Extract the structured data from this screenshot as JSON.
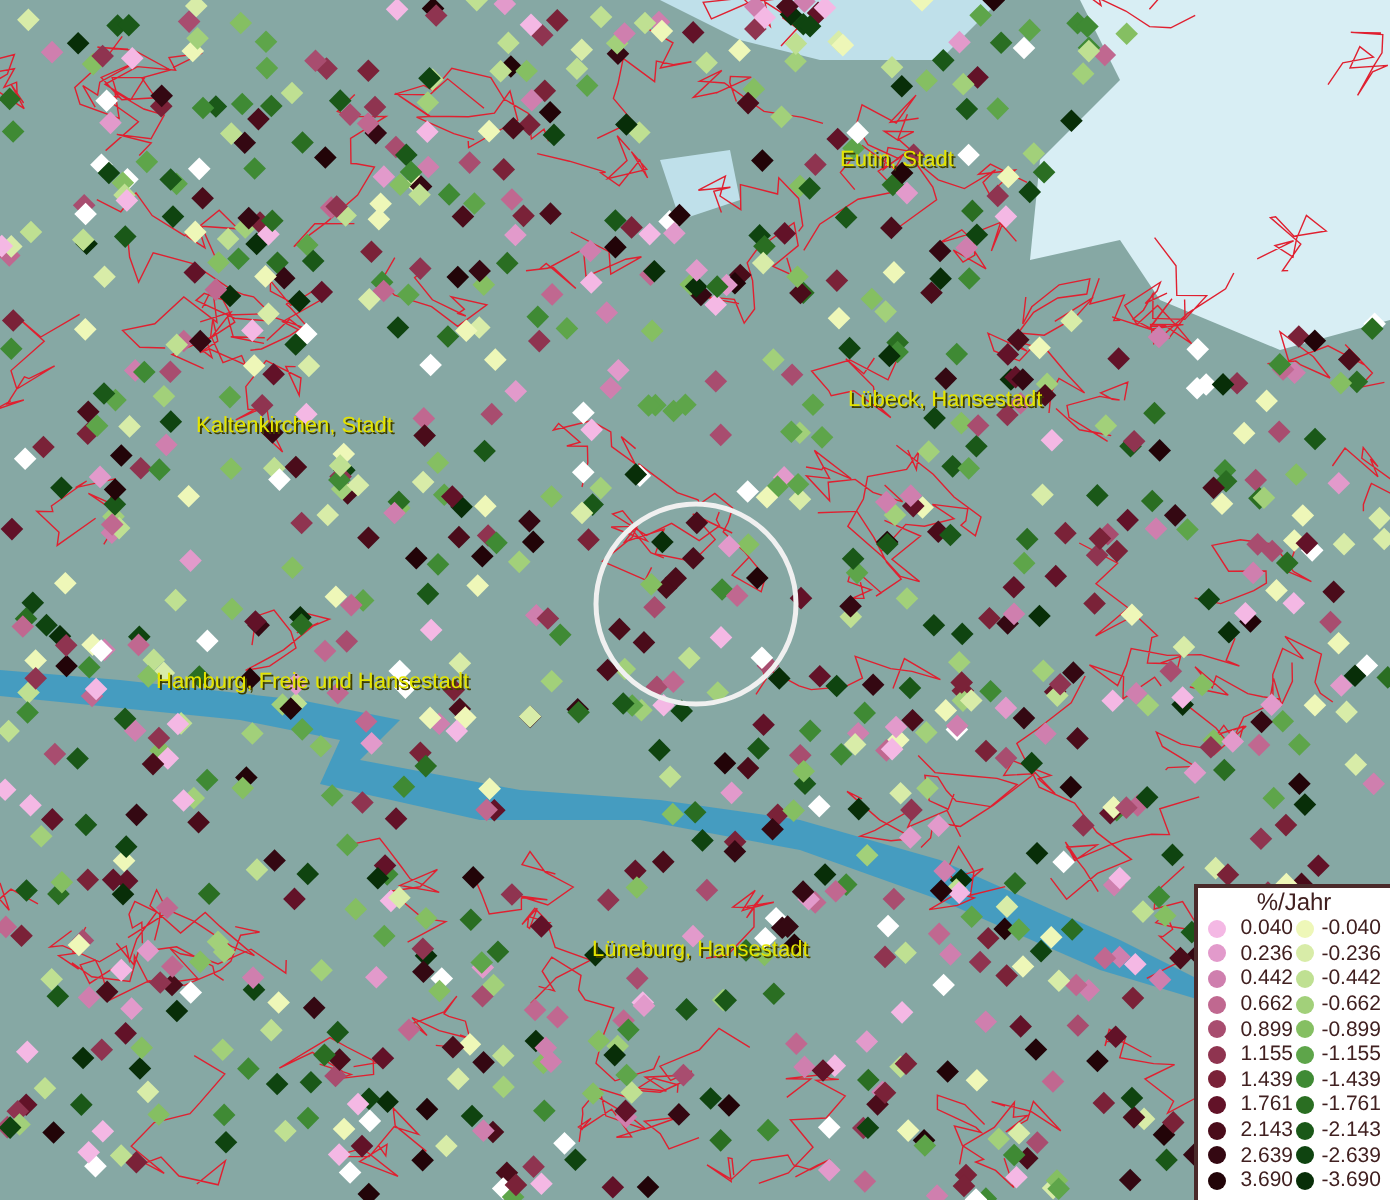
{
  "map": {
    "cities": [
      {
        "name": "Eutin, Stadt"
      },
      {
        "name": "Kaltenkirchen, Stadt"
      },
      {
        "name": "Lübeck, Hansestadt"
      },
      {
        "name": "Hamburg, Freie und Hansestadt"
      },
      {
        "name": "Lüneburg, Hansestadt"
      }
    ]
  },
  "legend": {
    "title": "%/Jahr",
    "columns": [
      {
        "entries": [
          {
            "label": "0.040",
            "color": "#f4b8e4"
          },
          {
            "label": "0.236",
            "color": "#e29acb"
          },
          {
            "label": "0.442",
            "color": "#cf7fae"
          },
          {
            "label": "0.662",
            "color": "#c06890"
          },
          {
            "label": "0.899",
            "color": "#a84d6f"
          },
          {
            "label": "1.155",
            "color": "#8f3450"
          },
          {
            "label": "1.439",
            "color": "#7a2238"
          },
          {
            "label": "1.761",
            "color": "#621228"
          },
          {
            "label": "2.143",
            "color": "#4a0c1a"
          },
          {
            "label": "2.639",
            "color": "#340812"
          },
          {
            "label": "3.690",
            "color": "#220408"
          }
        ]
      },
      {
        "entries": [
          {
            "label": "-0.040",
            "color": "#eef7b8"
          },
          {
            "label": "-0.236",
            "color": "#d8eca8"
          },
          {
            "label": "-0.442",
            "color": "#bfe092"
          },
          {
            "label": "-0.662",
            "color": "#a2d07a"
          },
          {
            "label": "-0.899",
            "color": "#85bf62"
          },
          {
            "label": "-1.155",
            "color": "#5ea54a"
          },
          {
            "label": "-1.439",
            "color": "#3f8a34"
          },
          {
            "label": "-1.761",
            "color": "#2a6e22"
          },
          {
            "label": "-2.143",
            "color": "#1a5818"
          },
          {
            "label": "-2.639",
            "color": "#0f4410"
          },
          {
            "label": "-3.690",
            "color": "#082e08"
          }
        ]
      }
    ]
  }
}
